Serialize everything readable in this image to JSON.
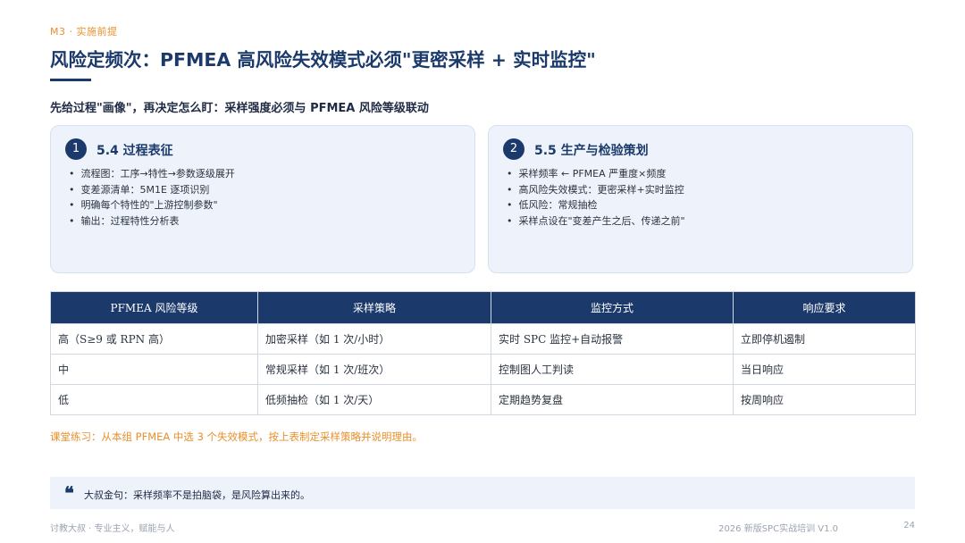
{
  "header": {
    "section_tag": "M3 · 实施前提",
    "title": "风险定频次：PFMEA 高风险失效模式必须\"更密采样 + 实时监控\"",
    "subtitle": "先给过程\"画像\"，再决定怎么盯：采样强度必须与 PFMEA 风险等级联动"
  },
  "cards": [
    {
      "number": "1",
      "title": "5.4 过程表征",
      "bullets": [
        "流程图：工序→特性→参数逐级展开",
        "变差源清单：5M1E 逐项识别",
        "明确每个特性的\"上游控制参数\"",
        "输出：过程特性分析表"
      ]
    },
    {
      "number": "2",
      "title": "5.5 生产与检验策划",
      "bullets": [
        "采样频率 ← PFMEA 严重度×频度",
        "高风险失效模式：更密采样+实时监控",
        "低风险：常规抽检",
        "采样点设在\"变差产生之后、传递之前\""
      ]
    }
  ],
  "table": {
    "headers": [
      "PFMEA 风险等级",
      "采样策略",
      "监控方式",
      "响应要求"
    ],
    "rows": [
      [
        "高（S≥9 或 RPN 高）",
        "加密采样（如 1 次/小时）",
        "实时 SPC 监控+自动报警",
        "立即停机遏制"
      ],
      [
        "中",
        "常规采样（如 1 次/班次）",
        "控制图人工判读",
        "当日响应"
      ],
      [
        "低",
        "低频抽检（如 1 次/天）",
        "定期趋势复盘",
        "按周响应"
      ]
    ]
  },
  "exercise": "课堂练习：从本组 PFMEA 中选 3 个失效模式，按上表制定采样策略并说明理由。",
  "quote": {
    "mark": "❝",
    "text": "大叔金句：采样频率不是拍脑袋，是风险算出来的。"
  },
  "footer": {
    "left": "讨教大叔 · 专业主义，赋能与人",
    "right": "2026 新版SPC实战培训 V1.0",
    "page": "24"
  },
  "colors": {
    "primary": "#1b3a6b",
    "accent": "#e8902c",
    "card_bg": "#eef3fb"
  }
}
